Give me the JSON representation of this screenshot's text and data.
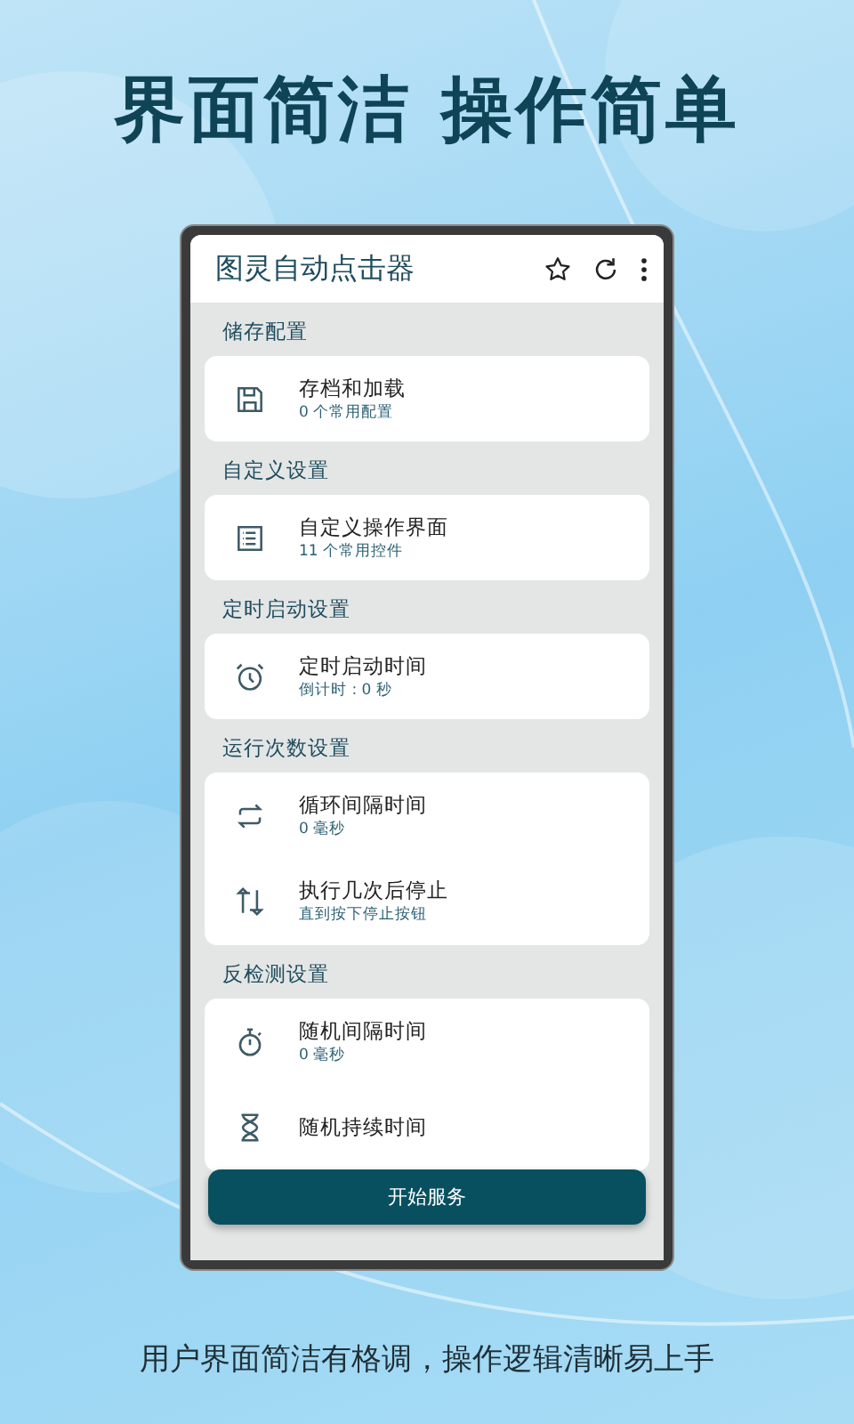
{
  "headline": "界面简洁 操作简单",
  "app": {
    "title": "图灵自动点击器",
    "sections": [
      {
        "title": "储存配置",
        "items": [
          {
            "title": "存档和加载",
            "subtitle": "0 个常用配置"
          }
        ]
      },
      {
        "title": "自定义设置",
        "items": [
          {
            "title": "自定义操作界面",
            "subtitle": "11 个常用控件"
          }
        ]
      },
      {
        "title": "定时启动设置",
        "items": [
          {
            "title": "定时启动时间",
            "subtitle": "倒计时 : 0 秒"
          }
        ]
      },
      {
        "title": "运行次数设置",
        "items": [
          {
            "title": "循环间隔时间",
            "subtitle": "0 毫秒"
          },
          {
            "title": "执行几次后停止",
            "subtitle": "直到按下停止按钮"
          }
        ]
      },
      {
        "title": "反检测设置",
        "items": [
          {
            "title": "随机间隔时间",
            "subtitle": "0 毫秒"
          },
          {
            "title": "随机持续时间"
          }
        ]
      }
    ],
    "button": "开始服务"
  },
  "caption": "用户界面简洁有格调，操作逻辑清晰易上手"
}
